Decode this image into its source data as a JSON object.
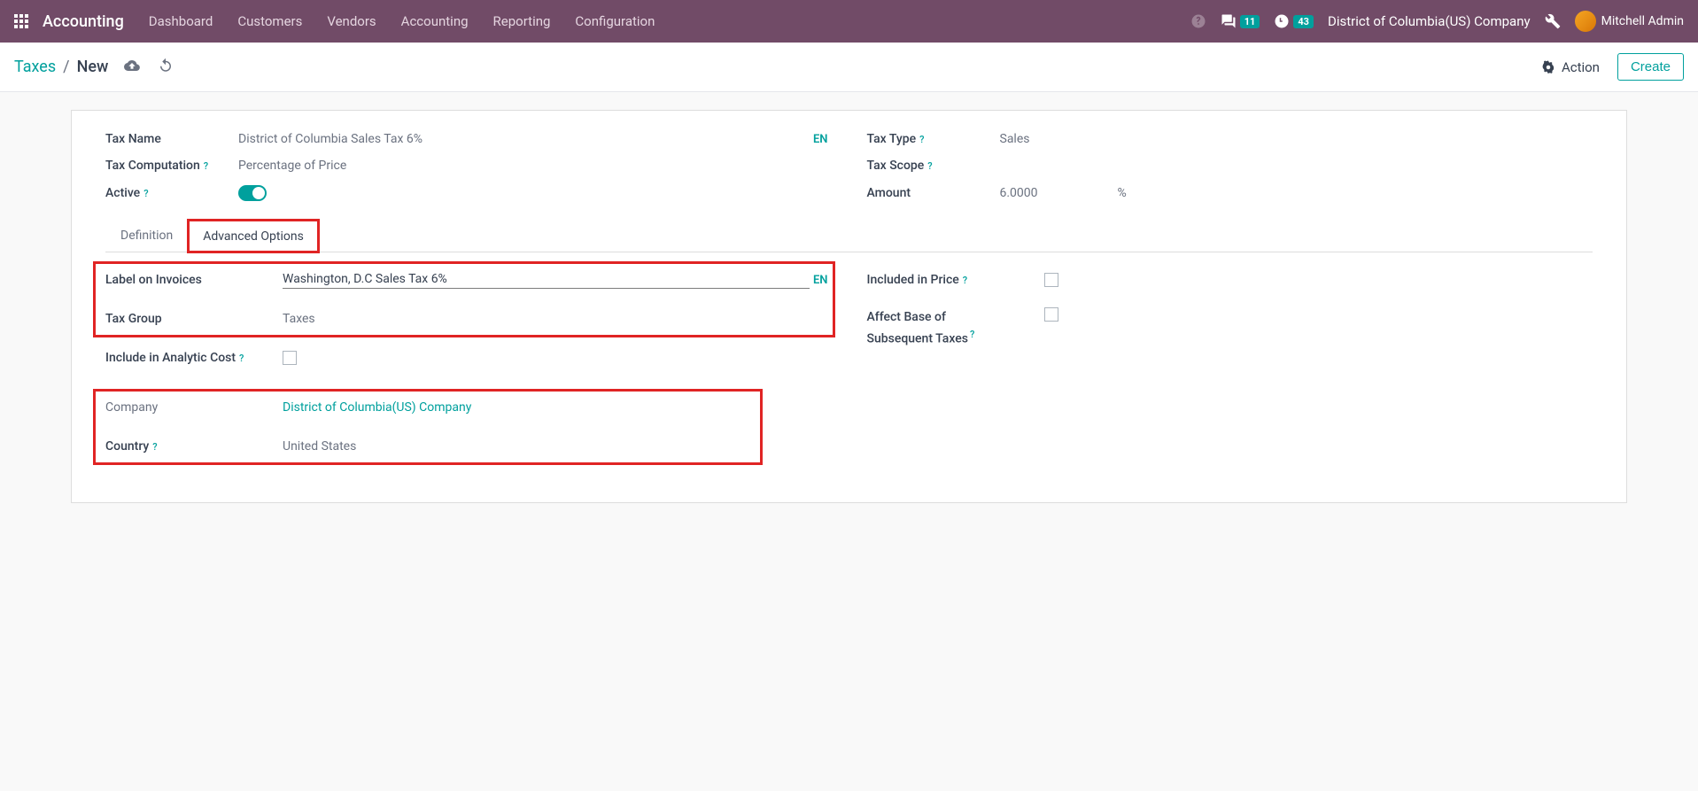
{
  "nav": {
    "app_title": "Accounting",
    "menu": [
      "Dashboard",
      "Customers",
      "Vendors",
      "Accounting",
      "Reporting",
      "Configuration"
    ],
    "msg_count": "11",
    "activity_count": "43",
    "company": "District of Columbia(US) Company",
    "user": "Mitchell Admin"
  },
  "breadcrumb": {
    "root": "Taxes",
    "current": "New",
    "action_label": "Action",
    "create_label": "Create"
  },
  "form": {
    "tax_name_label": "Tax Name",
    "tax_name_value": "District of Columbia Sales Tax 6%",
    "en_badge": "EN",
    "tax_type_label": "Tax Type",
    "tax_type_value": "Sales",
    "tax_comp_label": "Tax Computation",
    "tax_comp_value": "Percentage of Price",
    "tax_scope_label": "Tax Scope",
    "active_label": "Active",
    "amount_label": "Amount",
    "amount_value": "6.0000",
    "amount_unit": "%"
  },
  "tabs": {
    "definition": "Definition",
    "advanced": "Advanced Options"
  },
  "advanced": {
    "label_invoices_label": "Label on Invoices",
    "label_invoices_value": "Washington, D.C Sales Tax 6%",
    "tax_group_label": "Tax Group",
    "tax_group_value": "Taxes",
    "include_analytic_label": "Include in Analytic Cost",
    "company_label": "Company",
    "company_value": "District of Columbia(US) Company",
    "country_label": "Country",
    "country_value": "United States",
    "included_price_label": "Included in Price",
    "affect_base_label1": "Affect Base of",
    "affect_base_label2": "Subsequent Taxes"
  }
}
